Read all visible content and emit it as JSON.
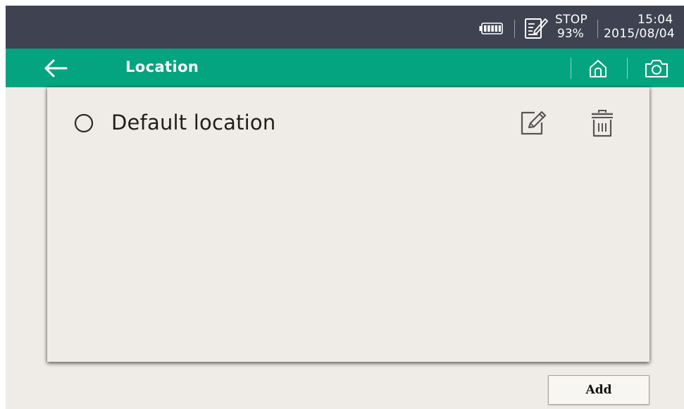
{
  "status_bar": {
    "battery_icon": "battery-full-icon",
    "recorder_icon": "notepad-edit-icon",
    "record_state": "STOP",
    "storage_percent": "93%",
    "time": "15:04",
    "date": "2015/08/04"
  },
  "title_bar": {
    "back_icon": "arrow-left-icon",
    "title": "Location",
    "home_icon": "home-icon",
    "camera_icon": "camera-icon"
  },
  "locations": [
    {
      "name": "Default location",
      "selected": false,
      "edit_icon": "edit-icon",
      "delete_icon": "trash-icon"
    }
  ],
  "actions": {
    "add_label": "Add"
  },
  "colors": {
    "status_bar_bg": "#3f4250",
    "title_bar_bg": "#05a481",
    "screen_bg": "#efebe7"
  }
}
